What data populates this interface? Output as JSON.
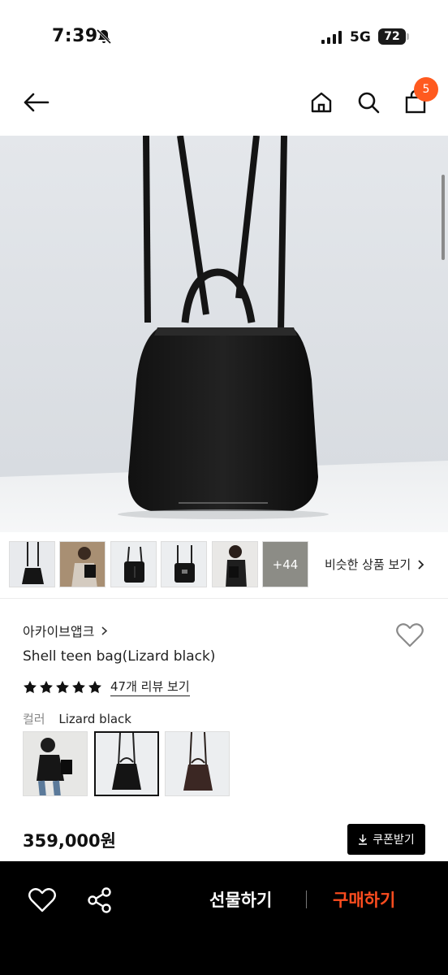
{
  "status_bar": {
    "time": "7:39",
    "network": "5G",
    "battery": "72"
  },
  "header": {
    "cart_count": "5"
  },
  "thumbnails": {
    "more_count": "+44",
    "similar_label": "비슷한 상품 보기"
  },
  "product": {
    "brand": "아카이브앱크",
    "name": "Shell teen bag(Lizard black)",
    "rating_stars": 5,
    "review_link": "47개 리뷰 보기",
    "color_label": "컬러",
    "color_value": "Lizard black",
    "price": "359,000원",
    "coupon_label": "쿠폰받기"
  },
  "bottom_bar": {
    "gift_label": "선물하기",
    "buy_label": "구매하기"
  },
  "colors": {
    "accent": "#ff4d1f",
    "badge": "#ff5a1f"
  }
}
